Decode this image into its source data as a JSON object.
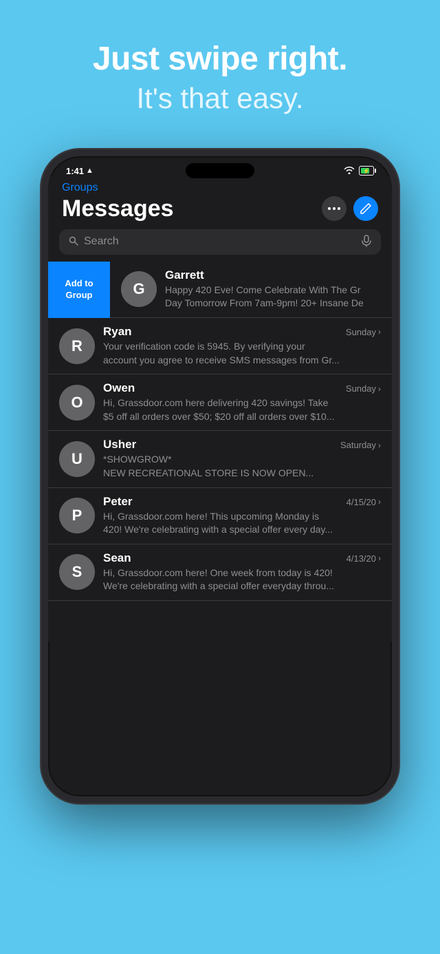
{
  "hero": {
    "line1": "Just swipe right.",
    "line2": "It's that easy."
  },
  "status_bar": {
    "time": "1:41",
    "wifi": true,
    "battery": true
  },
  "screen": {
    "back_label": "Groups",
    "title": "Messages",
    "search_placeholder": "Search",
    "more_button_label": "more",
    "compose_button_label": "compose",
    "swipe_action_label": "Add to\nGroup",
    "messages": [
      {
        "id": "garrett",
        "avatar_letter": "G",
        "name": "Garrett",
        "time": "",
        "preview_line1": "Happy 420 Eve! Come Celebrate With The Gr",
        "preview_line2": "Day Tomorrow From 7am-9pm! 20+ Insane De",
        "swiped": true
      },
      {
        "id": "ryan",
        "avatar_letter": "R",
        "name": "Ryan",
        "time": "Sunday",
        "preview_line1": "Your verification code is 5945. By verifying your",
        "preview_line2": "account you agree to receive SMS messages from Gr...",
        "swiped": false
      },
      {
        "id": "owen",
        "avatar_letter": "O",
        "name": "Owen",
        "time": "Sunday",
        "preview_line1": "Hi, Grassdoor.com here delivering 420 savings! Take",
        "preview_line2": "$5 off all orders over $50; $20 off all orders over $10...",
        "swiped": false
      },
      {
        "id": "usher",
        "avatar_letter": "U",
        "name": "Usher",
        "time": "Saturday",
        "preview_line1": "*SHOWGROW*",
        "preview_line2": "NEW RECREATIONAL STORE IS NOW OPEN...",
        "swiped": false
      },
      {
        "id": "peter",
        "avatar_letter": "P",
        "name": "Peter",
        "time": "4/15/20",
        "preview_line1": "Hi, Grassdoor.com here! This upcoming Monday is",
        "preview_line2": "420! We're celebrating with a special offer every day...",
        "swiped": false
      },
      {
        "id": "sean",
        "avatar_letter": "S",
        "name": "Sean",
        "time": "4/13/20",
        "preview_line1": "Hi, Grassdoor.com here! One week from today is 420!",
        "preview_line2": "We're celebrating with a special offer everyday throu...",
        "swiped": false
      }
    ]
  }
}
